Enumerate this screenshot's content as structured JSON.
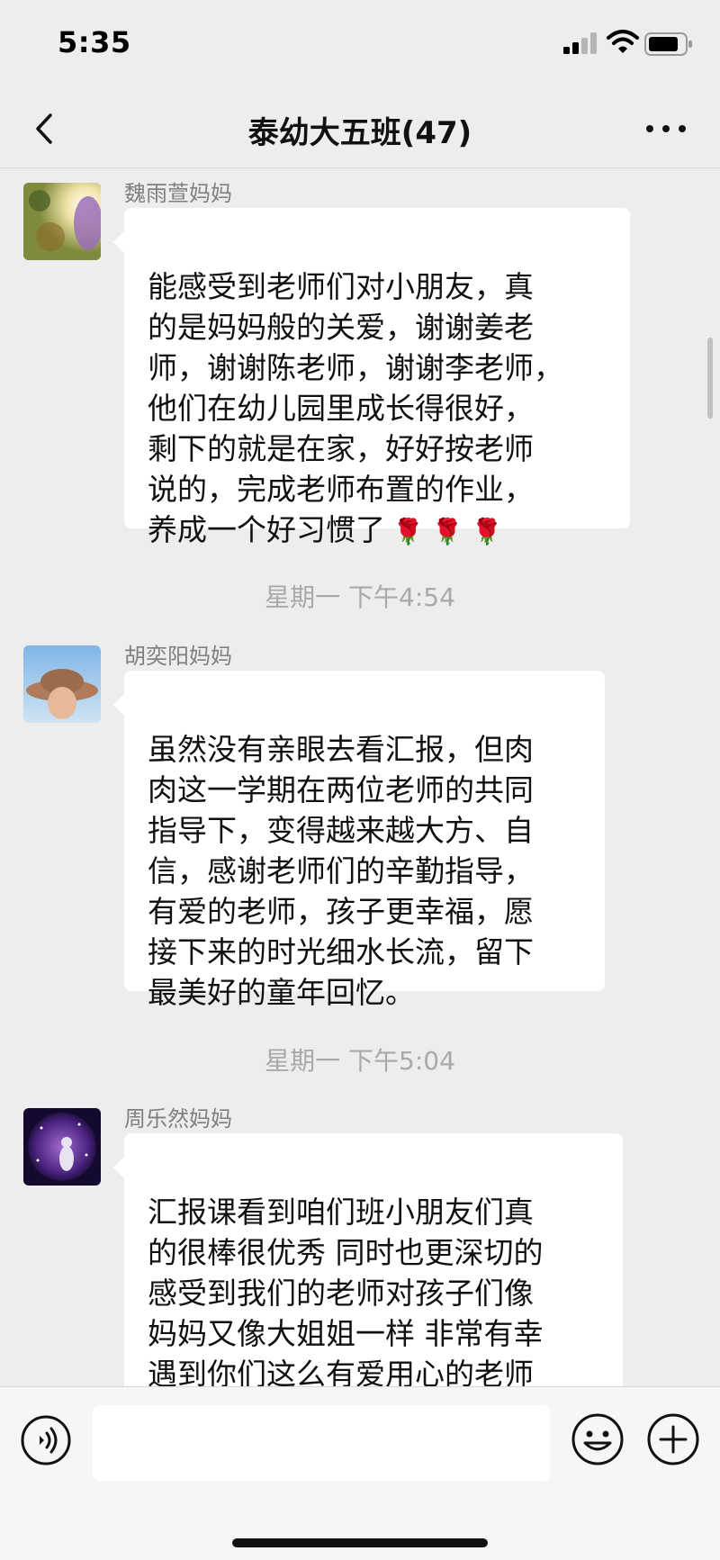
{
  "status_bar": {
    "time": "5:35"
  },
  "nav": {
    "title": "泰幼大五班(47)"
  },
  "messages": [
    {
      "sender": "魏雨萱妈妈",
      "text": "能感受到老师们对小朋友，真\n的是妈妈般的关爱，谢谢姜老\n师，谢谢陈老师，谢谢李老师，\n他们在幼儿园里成长得很好，\n剩下的就是在家，好好按老师\n说的，完成老师布置的作业，\n养成一个好习惯了",
      "emoji": "🌹 🌹 🌹"
    },
    {
      "timestamp": "星期一 下午4:54",
      "sender": "胡奕阳妈妈",
      "text": "虽然没有亲眼去看汇报，但肉\n肉这一学期在两位老师的共同\n指导下，变得越来越大方、自\n信，感谢老师们的辛勤指导，\n有爱的老师，孩子更幸福，愿\n接下来的时光细水长流，留下\n最美好的童年回忆。"
    },
    {
      "timestamp": "星期一 下午5:04",
      "sender": "周乐然妈妈",
      "text": "汇报课看到咱们班小朋友们真\n的很棒很优秀 同时也更深切的\n感受到我们的老师对孩子们像\n妈妈又像大姐姐一样  非常有幸\n遇到你们这么有爱用心的老师\n感谢感谢",
      "emoji": "🌹"
    }
  ],
  "input_bar": {
    "placeholder": ""
  },
  "icons": {
    "back": "chevron-left-icon",
    "more": "ellipsis-icon",
    "voice": "voice-icon",
    "emoji": "smiley-icon",
    "plus": "plus-icon"
  },
  "colors": {
    "background": "#ededed",
    "bubble": "#ffffff",
    "meta_text": "#a9a9a9"
  }
}
